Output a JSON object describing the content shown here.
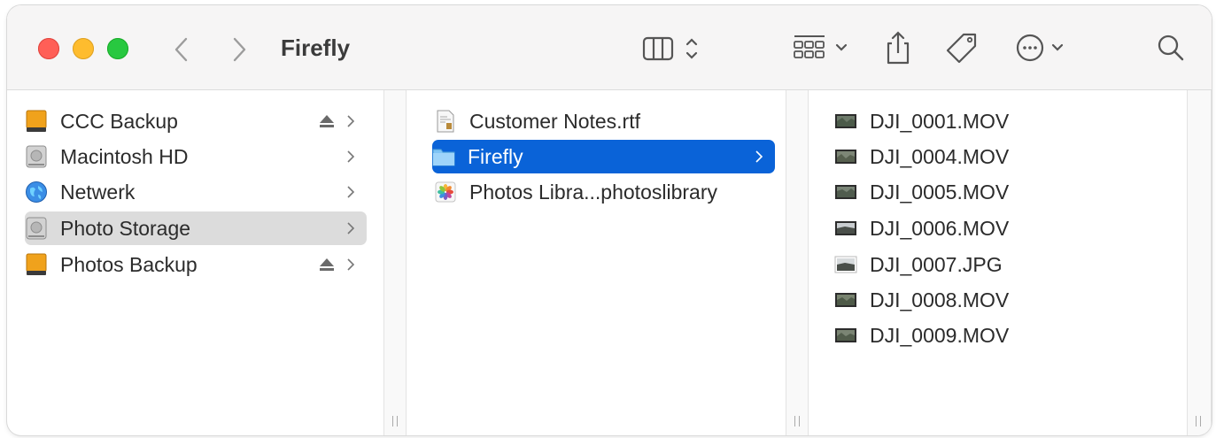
{
  "window": {
    "title": "Firefly",
    "accent_color": "#0a63d8",
    "traffic_lights": [
      "close",
      "minimize",
      "zoom"
    ]
  },
  "toolbar": {
    "back_icon": "chevron-left-icon",
    "forward_icon": "chevron-right-icon",
    "view_icon": "column-view-icon",
    "group_icon": "group-grid-icon",
    "share_icon": "share-icon",
    "tag_icon": "tag-icon",
    "more_icon": "ellipsis-circle-icon",
    "search_icon": "search-icon"
  },
  "column1": {
    "items": [
      {
        "label": "CCC Backup",
        "icon": "external-drive-icon",
        "eject": true
      },
      {
        "label": "Macintosh HD",
        "icon": "internal-disk-icon",
        "eject": false
      },
      {
        "label": "Netwerk",
        "icon": "network-globe-icon",
        "eject": false
      },
      {
        "label": "Photo Storage",
        "icon": "internal-disk-icon",
        "eject": false,
        "selected": true
      },
      {
        "label": "Photos Backup",
        "icon": "external-drive-icon",
        "eject": true
      }
    ]
  },
  "column2": {
    "items": [
      {
        "label": "Customer Notes.rtf",
        "icon": "rtf-document-icon"
      },
      {
        "label": "Firefly",
        "icon": "folder-icon",
        "selected": true
      },
      {
        "label": "Photos Libra...photoslibrary",
        "icon": "photos-library-icon"
      }
    ]
  },
  "column3": {
    "items": [
      {
        "label": "DJI_0001.MOV",
        "icon": "video-thumbnail-icon"
      },
      {
        "label": "DJI_0004.MOV",
        "icon": "video-thumbnail-icon"
      },
      {
        "label": "DJI_0005.MOV",
        "icon": "video-thumbnail-icon"
      },
      {
        "label": "DJI_0006.MOV",
        "icon": "video-thumbnail-icon"
      },
      {
        "label": "DJI_0007.JPG",
        "icon": "image-thumbnail-icon"
      },
      {
        "label": "DJI_0008.MOV",
        "icon": "video-thumbnail-icon"
      },
      {
        "label": "DJI_0009.MOV",
        "icon": "video-thumbnail-icon"
      }
    ]
  }
}
